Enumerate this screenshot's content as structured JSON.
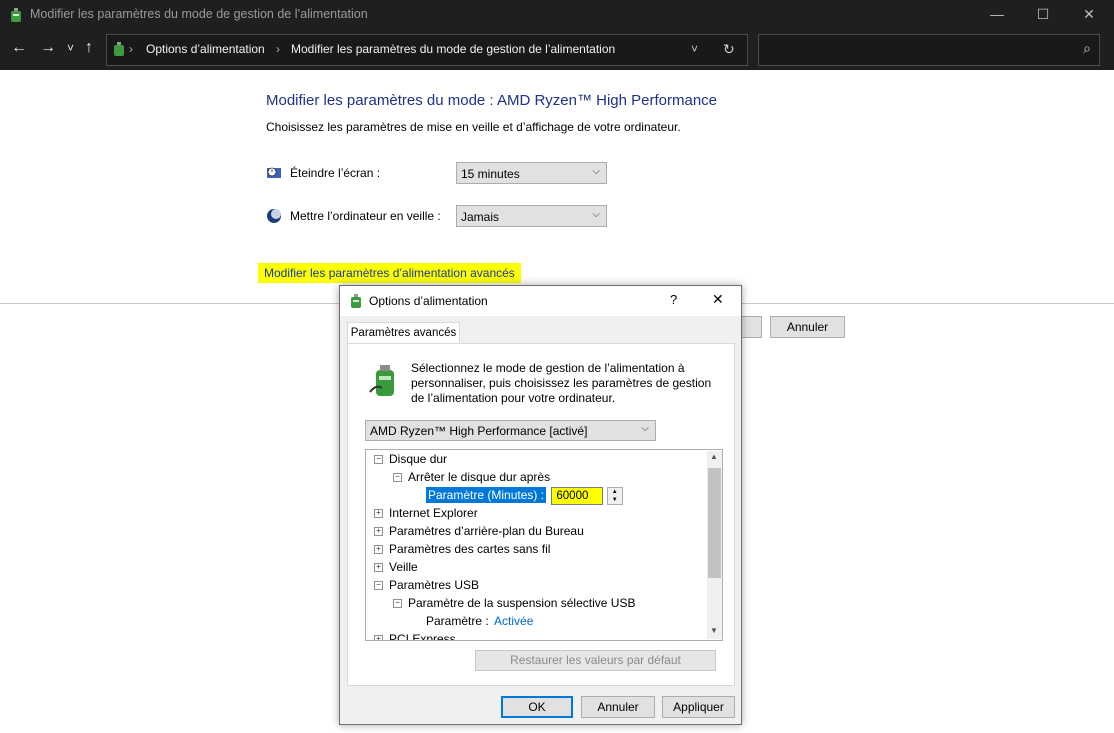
{
  "window": {
    "title": "Modifier les paramètres du mode de gestion de l’alimentation",
    "controls": {
      "minimize": "—",
      "maximize": "☐",
      "close": "✕"
    }
  },
  "nav": {
    "back": "←",
    "forward": "→",
    "recent": "˅",
    "up": "↑",
    "breadcrumb": [
      "Options d’alimentation",
      "Modifier les paramètres du mode de gestion de l’alimentation"
    ],
    "breadcrumb_sep": "›",
    "address_menu": "˅",
    "refresh": "↻",
    "search_placeholder": "",
    "search_glyph": "⌕"
  },
  "main": {
    "heading": "Modifier les paramètres du mode : AMD Ryzen™ High Performance",
    "subtext": "Choisissez les paramètres de mise en veille et d’affichage de votre ordinateur.",
    "screen_off_label": "Éteindre l’écran :",
    "screen_off_value": "15 minutes",
    "sleep_label": "Mettre l’ordinateur en veille :",
    "sleep_value": "Jamais",
    "advanced_link": "Modifier les paramètres d’alimentation avancés",
    "cancel_button": "Annuler"
  },
  "dialog": {
    "title": "Options d’alimentation",
    "help": "?",
    "close": "✕",
    "tab": "Paramètres avancés",
    "intro": [
      "Sélectionnez le mode de gestion de l’alimentation à",
      "personnaliser, puis choisissez les paramètres de gestion",
      "de l’alimentation pour votre ordinateur."
    ],
    "plan_value": "AMD Ryzen™ High Performance [activé]",
    "tree": {
      "disque_dur": "Disque dur",
      "arreter": "Arrêter le disque dur après",
      "param_minutes_label": "Paramètre (Minutes) :",
      "param_minutes_value": "60000",
      "internet_explorer": "Internet Explorer",
      "arriere_plan": "Paramètres d’arrière-plan du Bureau",
      "cartes_sans_fil": "Paramètres des cartes sans fil",
      "veille": "Veille",
      "usb": "Paramètres USB",
      "suspension_usb": "Paramètre de la suspension sélective USB",
      "parametre_label": "Paramètre :",
      "parametre_value": "Activée",
      "pci": "PCI Express",
      "collapse_glyph": "−",
      "expand_glyph": "+"
    },
    "restore_button": "Restaurer les valeurs par défaut",
    "ok_button": "OK",
    "cancel_button": "Annuler",
    "apply_button": "Appliquer"
  },
  "colors": {
    "titlebar_bg": "#1f1f1f",
    "heading_blue": "#1e3287",
    "highlight_yellow": "#fbff00",
    "selection_blue": "#0078d7",
    "link_blue": "#0066cc"
  }
}
